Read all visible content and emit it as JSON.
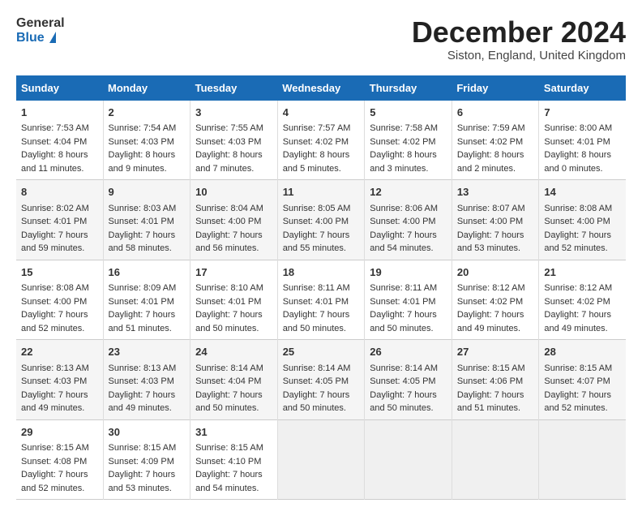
{
  "header": {
    "logo_line1": "General",
    "logo_line2": "Blue",
    "month_title": "December 2024",
    "subtitle": "Siston, England, United Kingdom"
  },
  "days_of_week": [
    "Sunday",
    "Monday",
    "Tuesday",
    "Wednesday",
    "Thursday",
    "Friday",
    "Saturday"
  ],
  "weeks": [
    [
      {
        "day": "1",
        "lines": [
          "Sunrise: 7:53 AM",
          "Sunset: 4:04 PM",
          "Daylight: 8 hours",
          "and 11 minutes."
        ]
      },
      {
        "day": "2",
        "lines": [
          "Sunrise: 7:54 AM",
          "Sunset: 4:03 PM",
          "Daylight: 8 hours",
          "and 9 minutes."
        ]
      },
      {
        "day": "3",
        "lines": [
          "Sunrise: 7:55 AM",
          "Sunset: 4:03 PM",
          "Daylight: 8 hours",
          "and 7 minutes."
        ]
      },
      {
        "day": "4",
        "lines": [
          "Sunrise: 7:57 AM",
          "Sunset: 4:02 PM",
          "Daylight: 8 hours",
          "and 5 minutes."
        ]
      },
      {
        "day": "5",
        "lines": [
          "Sunrise: 7:58 AM",
          "Sunset: 4:02 PM",
          "Daylight: 8 hours",
          "and 3 minutes."
        ]
      },
      {
        "day": "6",
        "lines": [
          "Sunrise: 7:59 AM",
          "Sunset: 4:02 PM",
          "Daylight: 8 hours",
          "and 2 minutes."
        ]
      },
      {
        "day": "7",
        "lines": [
          "Sunrise: 8:00 AM",
          "Sunset: 4:01 PM",
          "Daylight: 8 hours",
          "and 0 minutes."
        ]
      }
    ],
    [
      {
        "day": "8",
        "lines": [
          "Sunrise: 8:02 AM",
          "Sunset: 4:01 PM",
          "Daylight: 7 hours",
          "and 59 minutes."
        ]
      },
      {
        "day": "9",
        "lines": [
          "Sunrise: 8:03 AM",
          "Sunset: 4:01 PM",
          "Daylight: 7 hours",
          "and 58 minutes."
        ]
      },
      {
        "day": "10",
        "lines": [
          "Sunrise: 8:04 AM",
          "Sunset: 4:00 PM",
          "Daylight: 7 hours",
          "and 56 minutes."
        ]
      },
      {
        "day": "11",
        "lines": [
          "Sunrise: 8:05 AM",
          "Sunset: 4:00 PM",
          "Daylight: 7 hours",
          "and 55 minutes."
        ]
      },
      {
        "day": "12",
        "lines": [
          "Sunrise: 8:06 AM",
          "Sunset: 4:00 PM",
          "Daylight: 7 hours",
          "and 54 minutes."
        ]
      },
      {
        "day": "13",
        "lines": [
          "Sunrise: 8:07 AM",
          "Sunset: 4:00 PM",
          "Daylight: 7 hours",
          "and 53 minutes."
        ]
      },
      {
        "day": "14",
        "lines": [
          "Sunrise: 8:08 AM",
          "Sunset: 4:00 PM",
          "Daylight: 7 hours",
          "and 52 minutes."
        ]
      }
    ],
    [
      {
        "day": "15",
        "lines": [
          "Sunrise: 8:08 AM",
          "Sunset: 4:00 PM",
          "Daylight: 7 hours",
          "and 52 minutes."
        ]
      },
      {
        "day": "16",
        "lines": [
          "Sunrise: 8:09 AM",
          "Sunset: 4:01 PM",
          "Daylight: 7 hours",
          "and 51 minutes."
        ]
      },
      {
        "day": "17",
        "lines": [
          "Sunrise: 8:10 AM",
          "Sunset: 4:01 PM",
          "Daylight: 7 hours",
          "and 50 minutes."
        ]
      },
      {
        "day": "18",
        "lines": [
          "Sunrise: 8:11 AM",
          "Sunset: 4:01 PM",
          "Daylight: 7 hours",
          "and 50 minutes."
        ]
      },
      {
        "day": "19",
        "lines": [
          "Sunrise: 8:11 AM",
          "Sunset: 4:01 PM",
          "Daylight: 7 hours",
          "and 50 minutes."
        ]
      },
      {
        "day": "20",
        "lines": [
          "Sunrise: 8:12 AM",
          "Sunset: 4:02 PM",
          "Daylight: 7 hours",
          "and 49 minutes."
        ]
      },
      {
        "day": "21",
        "lines": [
          "Sunrise: 8:12 AM",
          "Sunset: 4:02 PM",
          "Daylight: 7 hours",
          "and 49 minutes."
        ]
      }
    ],
    [
      {
        "day": "22",
        "lines": [
          "Sunrise: 8:13 AM",
          "Sunset: 4:03 PM",
          "Daylight: 7 hours",
          "and 49 minutes."
        ]
      },
      {
        "day": "23",
        "lines": [
          "Sunrise: 8:13 AM",
          "Sunset: 4:03 PM",
          "Daylight: 7 hours",
          "and 49 minutes."
        ]
      },
      {
        "day": "24",
        "lines": [
          "Sunrise: 8:14 AM",
          "Sunset: 4:04 PM",
          "Daylight: 7 hours",
          "and 50 minutes."
        ]
      },
      {
        "day": "25",
        "lines": [
          "Sunrise: 8:14 AM",
          "Sunset: 4:05 PM",
          "Daylight: 7 hours",
          "and 50 minutes."
        ]
      },
      {
        "day": "26",
        "lines": [
          "Sunrise: 8:14 AM",
          "Sunset: 4:05 PM",
          "Daylight: 7 hours",
          "and 50 minutes."
        ]
      },
      {
        "day": "27",
        "lines": [
          "Sunrise: 8:15 AM",
          "Sunset: 4:06 PM",
          "Daylight: 7 hours",
          "and 51 minutes."
        ]
      },
      {
        "day": "28",
        "lines": [
          "Sunrise: 8:15 AM",
          "Sunset: 4:07 PM",
          "Daylight: 7 hours",
          "and 52 minutes."
        ]
      }
    ],
    [
      {
        "day": "29",
        "lines": [
          "Sunrise: 8:15 AM",
          "Sunset: 4:08 PM",
          "Daylight: 7 hours",
          "and 52 minutes."
        ]
      },
      {
        "day": "30",
        "lines": [
          "Sunrise: 8:15 AM",
          "Sunset: 4:09 PM",
          "Daylight: 7 hours",
          "and 53 minutes."
        ]
      },
      {
        "day": "31",
        "lines": [
          "Sunrise: 8:15 AM",
          "Sunset: 4:10 PM",
          "Daylight: 7 hours",
          "and 54 minutes."
        ]
      },
      null,
      null,
      null,
      null
    ]
  ]
}
